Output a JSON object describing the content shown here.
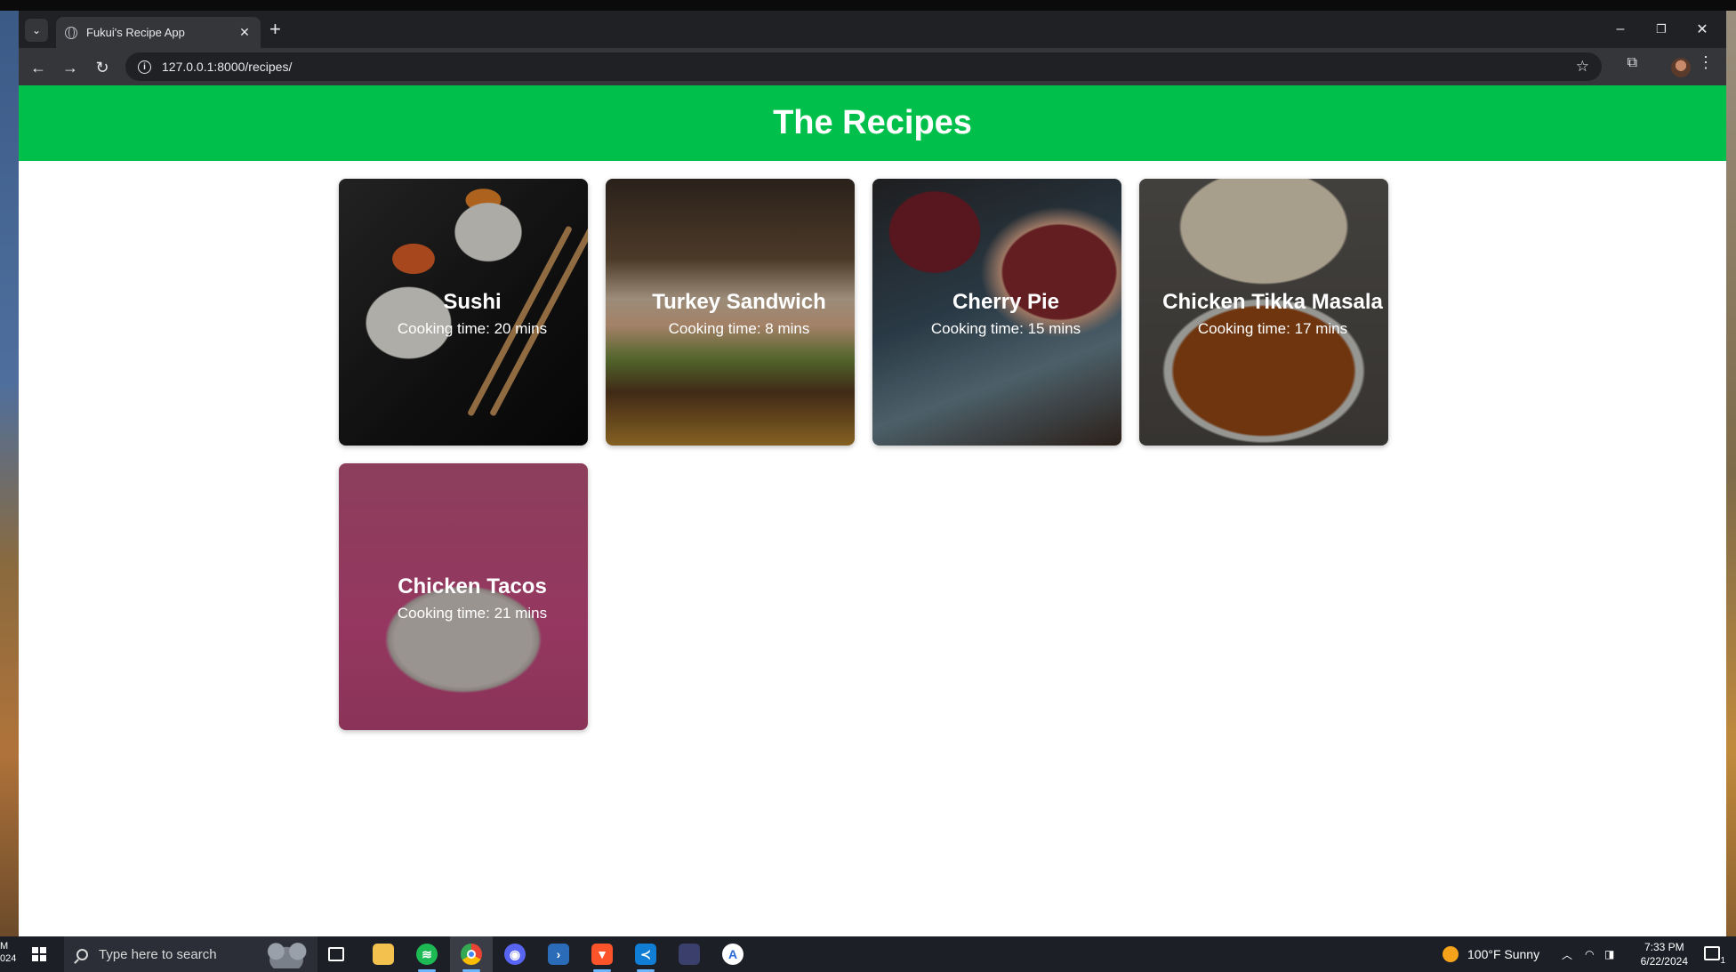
{
  "browser": {
    "tab_title": "Fukui's Recipe App",
    "tab_close": "✕",
    "new_tab": "+",
    "url": "127.0.0.1:8000/recipes/",
    "window_controls": {
      "minimize": "–",
      "restore": "❐",
      "close": "✕"
    }
  },
  "page": {
    "heading": "The Recipes",
    "header_color": "#00c04b"
  },
  "recipes": [
    {
      "name": "Sushi",
      "cooking_time": "Cooking time: 20 mins"
    },
    {
      "name": "Turkey Sandwich",
      "cooking_time": "Cooking time: 8 mins"
    },
    {
      "name": "Cherry Pie",
      "cooking_time": "Cooking time: 15 mins"
    },
    {
      "name": "Chicken Tikka Masala",
      "cooking_time": "Cooking time: 17 mins"
    },
    {
      "name": "Chicken Tacos",
      "cooking_time": "Cooking time: 21 mins"
    }
  ],
  "taskbar": {
    "search_placeholder": "Type here to search",
    "edge_text_1": "M",
    "edge_text_2": "024",
    "weather": "100°F  Sunny",
    "time": "7:33 PM",
    "date": "6/22/2024",
    "notification_count": "1",
    "apps": [
      "task-view-icon",
      "file-explorer-icon",
      "spotify-icon",
      "chrome-icon",
      "discord-icon",
      "powershell-icon",
      "brave-icon",
      "vscode-icon",
      "app-window-icon",
      "app-store-icon"
    ]
  }
}
